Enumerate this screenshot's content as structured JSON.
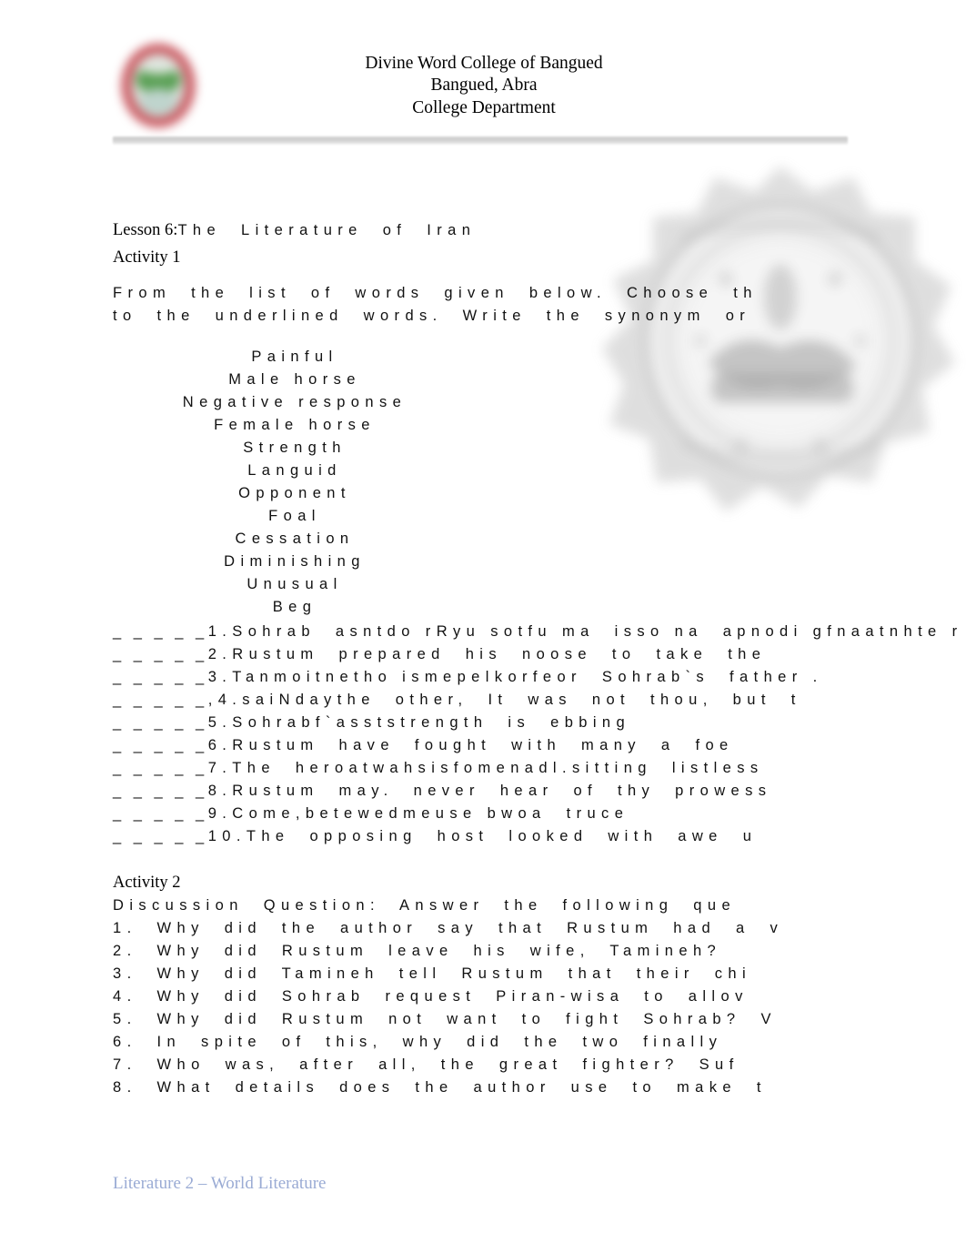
{
  "header": {
    "logo_icon": "college-seal-logo",
    "logo_colors": {
      "ring": "#c9565e",
      "center": "#5aa055",
      "inner": "#bcd0c4"
    },
    "lines": [
      "Divine Word College of Bangued",
      "Bangued, Abra",
      "College Department"
    ]
  },
  "watermark": {
    "icon": "blurred-college-seal-watermark",
    "color": "#9b9b9b"
  },
  "lesson": {
    "label": "Lesson 6:",
    "title": "The  Literature  of  Iran",
    "activity_label": "Activity 1"
  },
  "instructions": {
    "line1": "From  the  list  of  words  given  below.  Choose  th",
    "line2": "to  the  underlined  words.  Write  the  synonym  or"
  },
  "word_bank": [
    "Painful",
    "Male horse",
    "Negative response",
    "Female horse",
    "Strength",
    "Languid",
    "Opponent",
    "Foal",
    "Cessation",
    "Diminishing",
    "Unusual",
    "Beg"
  ],
  "items": [
    {
      "blank": "_ _ _ _ _",
      "number": "1.",
      "overlap": true,
      "under": "Sohrab  stood  in  front  of  Rustum  as  son  and  father .",
      "over": "            a  n  d      R y u      f u    a    i s s o  a    a p o d i  g f n a a t n h t e r .",
      "plain": "Sohrab  asntdo rRyu sotfu ma  isso na  apnodi gfnaatnhte r ."
    },
    {
      "blank": "_ _ _ _ _",
      "number": "2.",
      "overlap": false,
      "plain": "Rustum  prepared  his  noose  to  take  the"
    },
    {
      "blank": "_ _ _ _ _",
      "number": "3.",
      "overlap": true,
      "under": "Tamineh  is  the  one  looked  for  Sohrab`s  father .",
      "over": "  a n m o i t n e t h o    i s m e p e l k o r f e o r",
      "plain": "Tanmoitnetho ismepelkorfeor  Sohrab`s  father ."
    },
    {
      "blank": "_ _ _ _ _",
      "number": "4.",
      "overlap": true,
      "under": "Nay  said  the  other,  It  was  not  thou,  but  t",
      "over": ", s a i N d a",
      "plain": ",4.saiNdaythe  other,  It  was  not  thou,  but  t"
    },
    {
      "blank": "_ _ _ _ _",
      "number": "5.",
      "overlap": true,
      "under": "Sohrab`s  strength  is  ebbing",
      "over": "              f a s t .",
      "plain": "Sohrabf`asststrength  is  ebbing"
    },
    {
      "blank": "_ _ _ _ _",
      "number": "6.",
      "overlap": false,
      "plain": "Rustum  have  fought  with  many  a  foe"
    },
    {
      "blank": "_ _ _ _ _",
      "number": "7.",
      "overlap": true,
      "under": "The  hero  was  at  his  home  all  sitting  listless",
      "over": "          o a t w a h s i s f o m e n a d l .",
      "plain": "The  heroatwahsisfomenadl.sitting  listless"
    },
    {
      "blank": "_ _ _ _ _",
      "number": "8.",
      "overlap": false,
      "plain": "Rustum  may.  never  hear  of  thy  prowess"
    },
    {
      "blank": "_ _ _ _ _",
      "number": "9.",
      "overlap": true,
      "under": "Come,  let  there  be  between  us  two  a  truce",
      "over": "      b e t e w e e n e u s   t w o",
      "plain": "Come,betewedmeuse bwoa  truce"
    },
    {
      "blank": "_ _ _ _ _",
      "number": "10.",
      "overlap": false,
      "plain": "The  opposing  host  looked  with  awe  u"
    }
  ],
  "activity2": {
    "label": "Activity 2",
    "prompt": "Discussion  Question:  Answer  the  following  que",
    "questions": [
      "1.  Why  did  the  author  say  that  Rustum  had  a  v",
      "2.  Why  did  Rustum  leave  his  wife,  Tamineh?",
      "3.  Why  did  Tamineh  tell  Rustum  that  their  chi",
      "4.  Why  did  Sohrab  request  Piran-wisa  to  allov",
      "5.  Why  did  Rustum  not  want  to  fight  Sohrab?  V",
      "6.  In  spite  of  this,  why  did  the  two  finally",
      "7.  Who  was,  after  all,  the  great  fighter?  Suf",
      "8.  What  details  does  the  author  use  to  make  t"
    ]
  },
  "footer": {
    "text": "Literature 2 – World Literature",
    "color": "#9aabd4"
  }
}
